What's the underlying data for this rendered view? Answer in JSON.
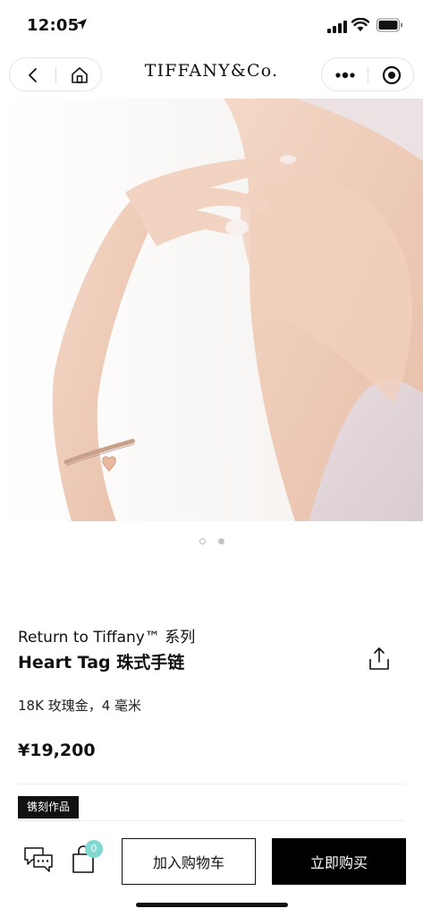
{
  "status_bar": {
    "time": "12:05"
  },
  "nav": {
    "brand": "TIFFANY&Co."
  },
  "product": {
    "series": "Return to Tiffany™ 系列",
    "title": "Heart Tag 珠式手链",
    "material": "18K 玫瑰金，4 毫米",
    "price": "¥19,200",
    "engraving_tag": "镌刻作品"
  },
  "carousel": {
    "total": 2,
    "current": 2
  },
  "actions": {
    "cart_count": "0",
    "add_to_cart": "加入购物车",
    "buy_now": "立即购买"
  },
  "colors": {
    "accent_badge": "#81d8d0",
    "primary": "#000000"
  },
  "icons": [
    "location-arrow-icon",
    "signal-icon",
    "wifi-icon",
    "battery-icon",
    "back-chevron-icon",
    "home-icon",
    "more-dots-icon",
    "miniprogram-close-icon",
    "share-icon",
    "chat-icon",
    "shopping-bag-icon"
  ]
}
